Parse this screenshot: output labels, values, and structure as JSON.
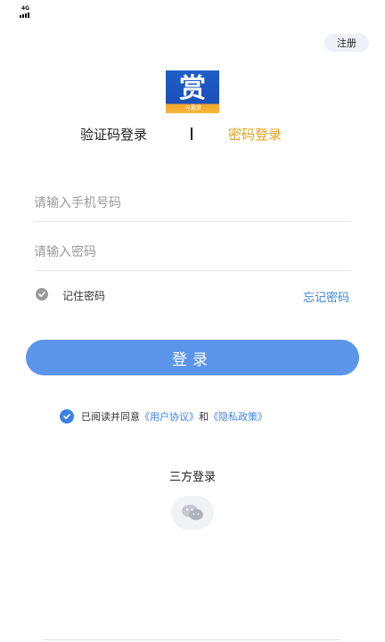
{
  "status_bar": {
    "network": "4G"
  },
  "header": {
    "register_label": "注册"
  },
  "logo": {
    "char": "赏",
    "sub": "·元悬赏"
  },
  "tabs": [
    {
      "label": "验证码登录",
      "active": false
    },
    {
      "label": "密码登录",
      "active": true
    }
  ],
  "form": {
    "phone_placeholder": "请输入手机号码",
    "phone_value": "",
    "password_placeholder": "请输入密码",
    "password_value": "",
    "remember_label": "记住密码",
    "remember_checked": true,
    "forgot_label": "忘记密码"
  },
  "login_button": "登录",
  "agreement": {
    "checked": true,
    "prefix": "已阅读并同意",
    "user_agreement": "《用户协议》",
    "and": "和",
    "privacy_policy": "《隐私政策》"
  },
  "third_party": {
    "title": "三方登录"
  },
  "colors": {
    "accent": "#3b82e6",
    "button": "#5b95ea",
    "active_tab": "#e0a21a"
  }
}
